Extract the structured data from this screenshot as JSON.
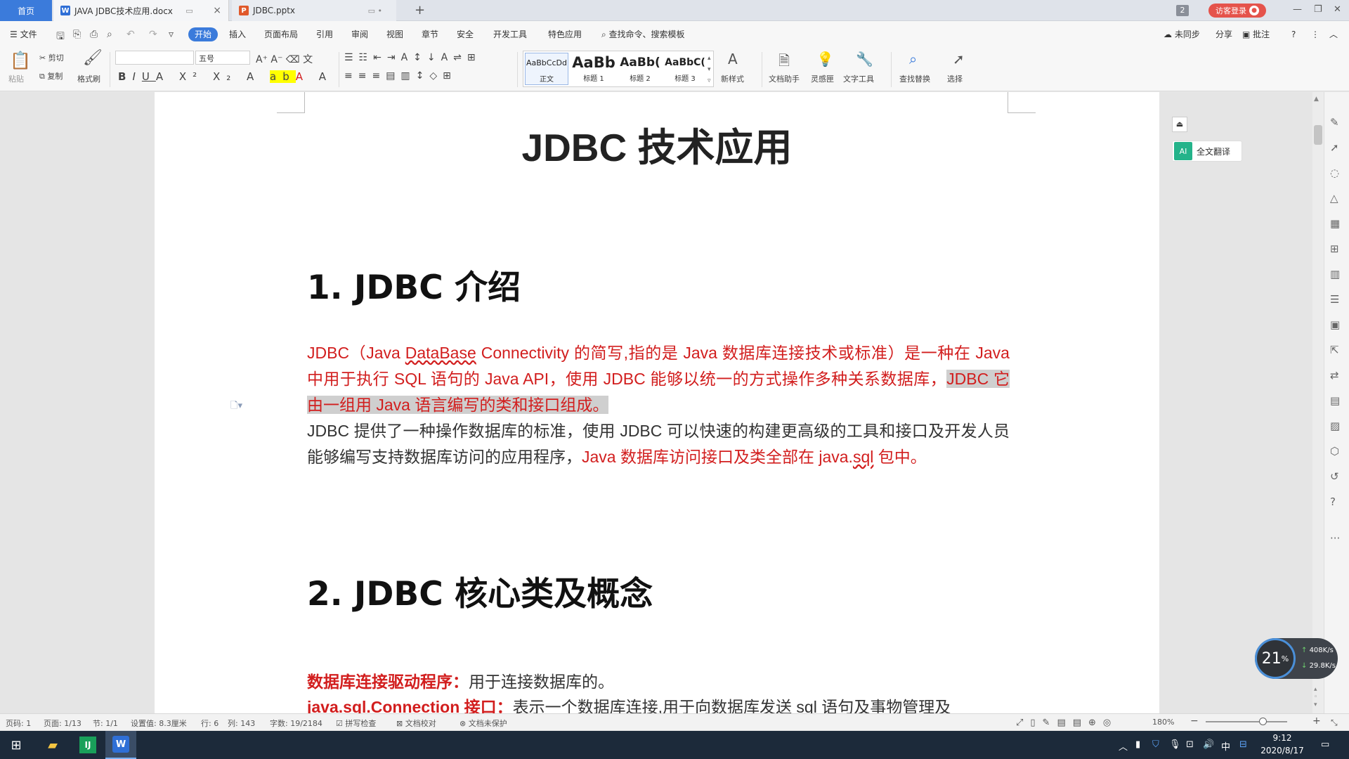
{
  "tabs": {
    "home": "首页",
    "doc_title": "JAVA JDBC技术应用.docx",
    "ppt_title": "JDBC.pptx",
    "add": "+",
    "window_count": "2",
    "login": "访客登录"
  },
  "menu": {
    "file": "文件",
    "start": "开始",
    "insert": "插入",
    "layout": "页面布局",
    "references": "引用",
    "review": "审阅",
    "view": "视图",
    "chapter": "章节",
    "security": "安全",
    "devtools": "开发工具",
    "special": "特色应用",
    "search": "查找命令、搜索模板",
    "sync": "未同步",
    "share": "分享",
    "comment": "批注"
  },
  "ribbon": {
    "paste": "粘贴",
    "cut": "剪切",
    "copy": "复制",
    "format_painter": "格式刷",
    "font_name": "",
    "font_size": "五号",
    "styles": [
      {
        "sample": "AaBbCcDd",
        "name": "正文"
      },
      {
        "sample": "AaBb",
        "name": "标题 1"
      },
      {
        "sample": "AaBb(",
        "name": "标题 2"
      },
      {
        "sample": "AaBbC(",
        "name": "标题 3"
      }
    ],
    "new_style": "新样式",
    "doc_assistant": "文档助手",
    "inspiration": "灵感匣",
    "text_tools": "文字工具",
    "find_replace": "查找替换",
    "select": "选择"
  },
  "document": {
    "title": "JDBC 技术应用",
    "h1": "1.  JDBC 介绍",
    "p1_a": "JDBC（Java ",
    "p1_b": "DataBase",
    "p1_c": " Connectivity 的简写,指的是 Java 数据库连接技术或标准）是一种在 Java 中用于执行 SQL 语句的 Java API，使用 JDBC 能够以统一的方式操作多种关系数据库，",
    "p1_hl": "JDBC 它由一组用 Java 语言编写的类和接口组成。",
    "p2_a": "JDBC 提供了一种操作数据库的标准，使用 JDBC 可以快速的构建更高级的工具和接口及开发人员能够编写支持数据库访问的应用程序，",
    "p2_b": "Java  数据库访问接口及类全部在 java.",
    "p2_c": "sql",
    "p2_d": " 包中。",
    "h2": "2.  JDBC 核心类及概念",
    "p3_label": "数据库连接驱动程序：",
    "p3_text": "用于连接数据库的。",
    "p4_label": "java.sql.Connection 接口：",
    "p4_text": "表示一个数据库连接,用于向数据库发送 sql 语句及事物管理及"
  },
  "side": {
    "translate": "全文翻译",
    "translate_icon": "AI"
  },
  "speed": {
    "percent": "21",
    "unit": "%",
    "up": "408K/s",
    "down": "29.8K/s"
  },
  "status": {
    "page_code": "页码: 1",
    "page": "页面: 1/13",
    "section": "节: 1/1",
    "setting": "设置值: 8.3厘米",
    "row": "行: 6",
    "col": "列: 143",
    "words": "字数: 19/2184",
    "spell": "拼写检查",
    "proof": "文档校对",
    "protect": "文档未保护",
    "zoom": "180%"
  },
  "taskbar": {
    "time": "9:12",
    "date": "2020/8/17",
    "ime": "中"
  },
  "colors": {
    "accent": "#3b7bdb",
    "red_text": "#d21e1e",
    "login": "#e5534b"
  }
}
